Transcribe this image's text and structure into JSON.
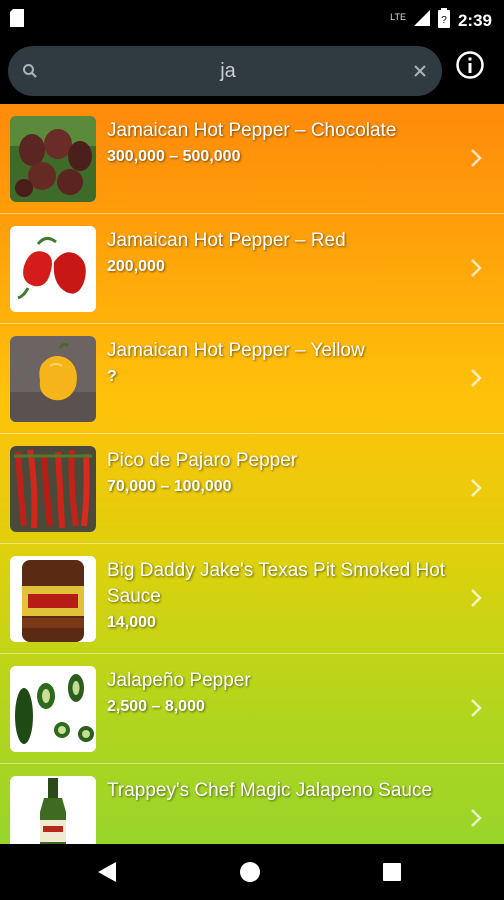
{
  "status": {
    "time": "2:39",
    "network": "LTE"
  },
  "search": {
    "value": "ja",
    "placeholder": ""
  },
  "items": [
    {
      "name": "Jamaican Hot Pepper – Chocolate",
      "shu": "300,000 – 500,000"
    },
    {
      "name": "Jamaican Hot Pepper – Red",
      "shu": "200,000"
    },
    {
      "name": "Jamaican Hot Pepper – Yellow",
      "shu": "?"
    },
    {
      "name": "Pico de Pajaro Pepper",
      "shu": "70,000 – 100,000"
    },
    {
      "name": "Big Daddy Jake's Texas Pit Smoked Hot Sauce",
      "shu": "14,000"
    },
    {
      "name": "Jalapeño Pepper",
      "shu": "2,500 – 8,000"
    },
    {
      "name": "Trappey's Chef Magic Jalapeno Sauce",
      "shu": ""
    }
  ],
  "icons": {
    "search": "search-icon",
    "clear": "close-icon",
    "info": "info-icon",
    "chevron": "chevron-right-icon",
    "back": "back-icon",
    "home": "home-icon",
    "recents": "recents-icon"
  },
  "colors": {
    "gradient_top": "#ff8a0a",
    "gradient_mid": "#ffc20a",
    "gradient_bottom": "#98d52a",
    "search_bg": "#2f3a41"
  }
}
